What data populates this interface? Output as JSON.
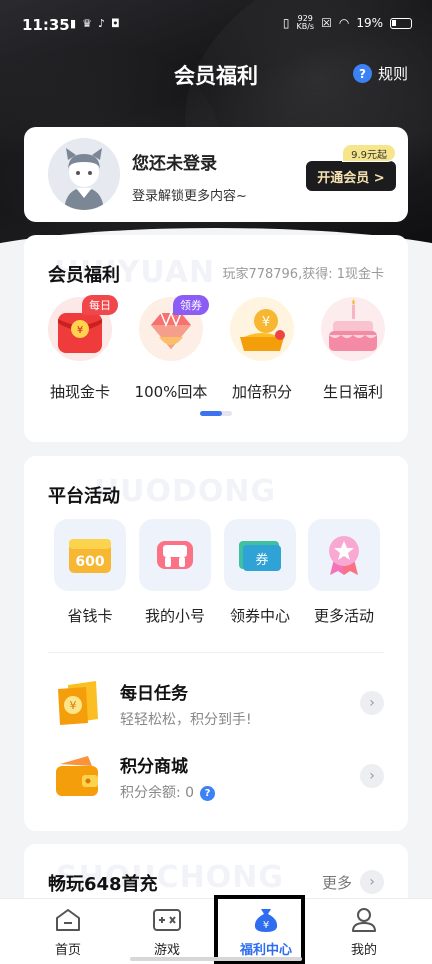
{
  "status_bar": {
    "time": "11:35",
    "net_speed_value": "929",
    "net_speed_unit": "KB/s",
    "battery": "19%"
  },
  "header": {
    "title": "会员福利",
    "rules_label": "规则"
  },
  "login_card": {
    "title": "您还未登录",
    "subtitle": "登录解锁更多内容~",
    "vip_button": "开通会员 >",
    "vip_price": "9.9元起"
  },
  "benefits": {
    "title": "会员福利",
    "watermark": "HUIYUAN",
    "player_info": "玩家778796,获得: 1现金卡",
    "items": [
      {
        "label": "抽现金卡",
        "tag": "每日",
        "tag_color": "#f0474b",
        "icon": "red-envelope-icon"
      },
      {
        "label": "100%回本",
        "tag": "领券",
        "tag_color": "#8b5cf6",
        "icon": "diamond-icon"
      },
      {
        "label": "加倍积分",
        "tag": "",
        "icon": "coin-stack-icon"
      },
      {
        "label": "生日福利",
        "tag": "",
        "icon": "birthday-cake-icon"
      }
    ]
  },
  "platform": {
    "title": "平台活动",
    "watermark": "HUODONG",
    "items": [
      {
        "label": "省钱卡",
        "icon": "saving-card-icon",
        "badge": "600"
      },
      {
        "label": "我的小号",
        "icon": "gamepad-icon"
      },
      {
        "label": "领券中心",
        "icon": "coupon-icon",
        "badge": "券"
      },
      {
        "label": "更多活动",
        "icon": "medal-icon"
      }
    ],
    "tasks": [
      {
        "title": "每日任务",
        "desc": "轻轻松松，积分到手!",
        "icon": "task-ticket-icon"
      },
      {
        "title": "积分商城",
        "desc": "积分余额:  0",
        "icon": "wallet-icon"
      }
    ]
  },
  "recharge": {
    "title": "畅玩648首充",
    "watermark": "SHOUCHONG",
    "more_label": "更多"
  },
  "bottom_nav": [
    {
      "label": "首页",
      "icon": "home-icon",
      "active": false
    },
    {
      "label": "游戏",
      "icon": "game-icon",
      "active": false
    },
    {
      "label": "福利中心",
      "icon": "money-bag-icon",
      "active": true
    },
    {
      "label": "我的",
      "icon": "user-icon",
      "active": false
    }
  ],
  "colors": {
    "accent": "#2f6df0",
    "dark_bg": "#141416",
    "vip_gold": "#f5e2b0"
  }
}
